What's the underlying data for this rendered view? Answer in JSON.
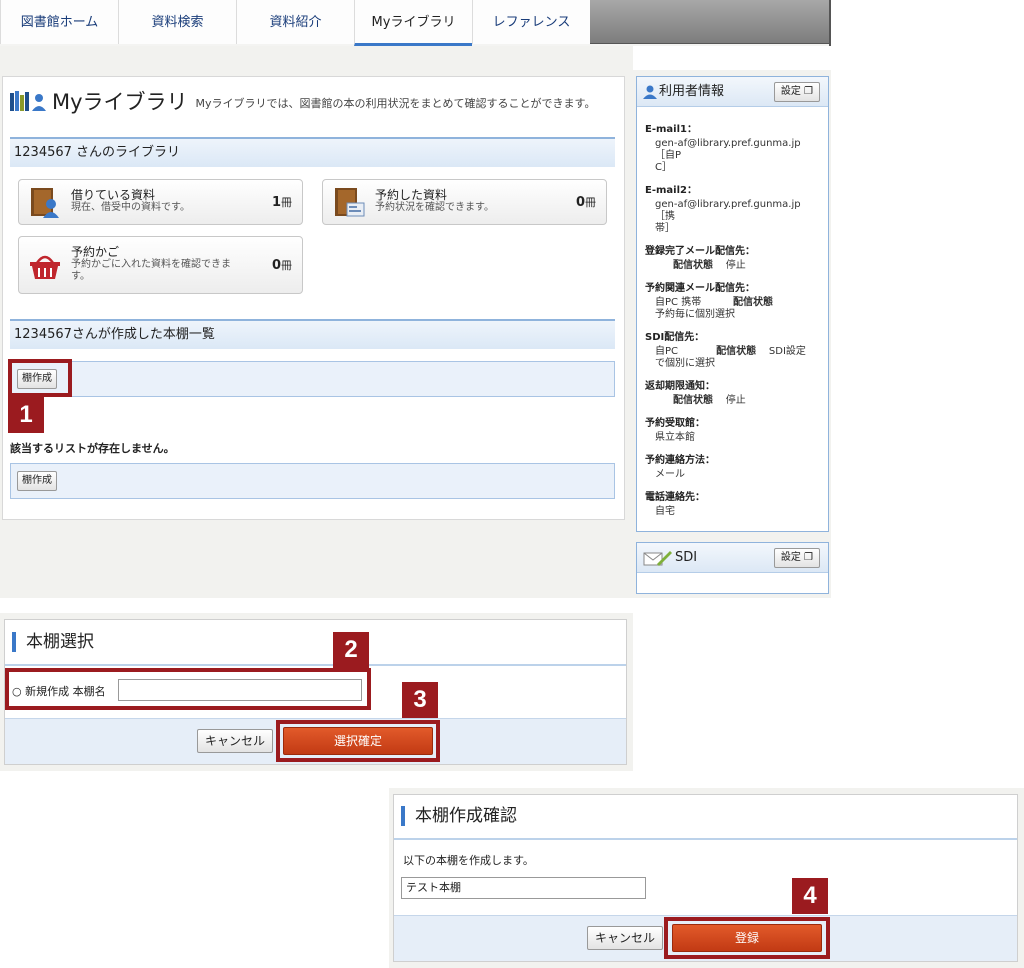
{
  "nav": {
    "tabs": [
      {
        "label": "図書館ホーム"
      },
      {
        "label": "資料検索"
      },
      {
        "label": "資料紹介"
      },
      {
        "label": "Myライブラリ"
      },
      {
        "label": "レファレンス"
      }
    ]
  },
  "main": {
    "title": "Myライブラリ",
    "description": "Myライブラリでは、図書館の本の利用状況をまとめて確認することができます。",
    "library_heading": "1234567 さんのライブラリ",
    "cards": {
      "borrowed": {
        "title": "借りている資料",
        "desc": "現在、借受中の資料です。",
        "count": "1",
        "unit": "冊"
      },
      "reserved": {
        "title": "予約した資料",
        "desc": "予約状況を確認できます。",
        "count": "0",
        "unit": "冊"
      },
      "cart": {
        "title": "予約かご",
        "desc_line1": "予約かごに入れた資料を確認できま",
        "desc_line2": "す。",
        "count": "0",
        "unit": "冊"
      }
    },
    "shelf_heading": "1234567さんが作成した本棚一覧",
    "create_shelf_label": "棚作成",
    "no_list_message": "該当するリストが存在しません。",
    "create_shelf_label_bottom": "棚作成"
  },
  "sidebar": {
    "user_info_title": "利用者情報",
    "settings_label": "設定",
    "fields": {
      "email1_key": "E-mail1：",
      "email1_line1": "gen-af@library.pref.gunma.jp［自P",
      "email1_line2": "C］",
      "email2_key": "E-mail2：",
      "email2_line1": "gen-af@library.pref.gunma.jp ［携",
      "email2_line2": "帯］",
      "reg_mail_key": "登録完了メール配信先：",
      "reg_mail_status_label": "配信状態",
      "reg_mail_status": "停止",
      "reserve_mail_key": "予約関連メール配信先：",
      "reserve_mail_targets": "自PC 携帯",
      "reserve_mail_status_label": "配信状態",
      "reserve_mail_note": "予約毎に個別選択",
      "sdi_key": "SDI配信先：",
      "sdi_target": "自PC",
      "sdi_status_label": "配信状態",
      "sdi_status": "SDI設定",
      "sdi_note": "で個別に選択",
      "return_key": "返却期限通知：",
      "return_status_label": "配信状態",
      "return_status": "停止",
      "pickup_key": "予約受取館：",
      "pickup_value": "県立本館",
      "contact_key": "予約連絡方法：",
      "contact_value": "メール",
      "phone_key": "電話連絡先：",
      "phone_value": "自宅"
    },
    "sdi_title": "SDI",
    "sdi_settings_label": "設定"
  },
  "dialog_select": {
    "title": "本棚選択",
    "radio_label": "新規作成 本棚名",
    "shelf_name_value": "",
    "cancel_label": "キャンセル",
    "confirm_label": "選択確定"
  },
  "dialog_confirm": {
    "title": "本棚作成確認",
    "message": "以下の本棚を作成します。",
    "shelf_name": "テスト本棚",
    "cancel_label": "キャンセル",
    "register_label": "登録"
  },
  "callouts": [
    "1",
    "2",
    "3",
    "4"
  ],
  "colors": {
    "callout": "#9b1b1f",
    "primary_button": "#d24a1e",
    "accent_blue": "#3a78c8"
  }
}
